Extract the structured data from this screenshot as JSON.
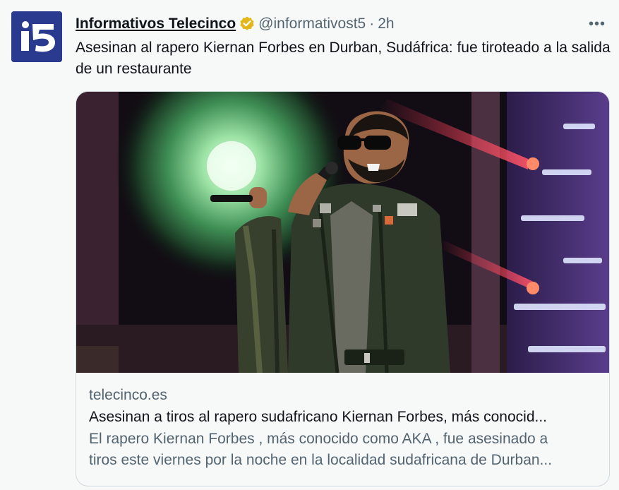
{
  "tweet": {
    "author_name": "Informativos Telecinco",
    "author_handle": "@informativost5",
    "separator": "·",
    "time": "2h",
    "more_label": "•••",
    "text": "Asesinan al rapero Kiernan Forbes en Durban, Sudáfrica: fue tiroteado a la salida de un restaurante",
    "verified_badge_color": "#e2b719",
    "avatar": {
      "logo_text": "i5",
      "bg_color": "#2a3a8e"
    }
  },
  "card": {
    "domain": "telecinco.es",
    "title": "Asesinan a tiros al rapero sudafricano Kiernan Forbes, más conocid...",
    "description_line1": "El rapero Kiernan Forbes , más conocido como AKA , fue asesinado a",
    "description_line2": "tiros este viernes por la noche en la localidad sudafricana de Durban..."
  }
}
